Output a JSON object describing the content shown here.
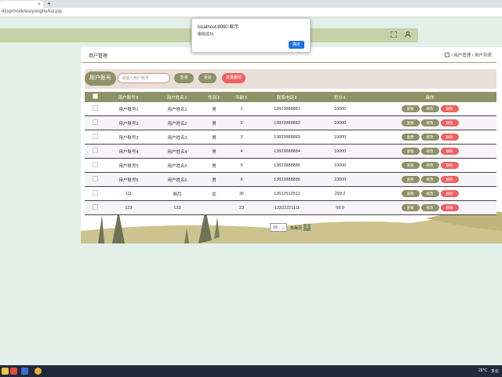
{
  "browser": {
    "url": "4/jsp/modules/yonghu/list.jsp",
    "new_tab": "+",
    "tab_close": "×"
  },
  "header": {
    "fullscreen_icon": "expand-icon",
    "user_icon": "user-icon"
  },
  "page": {
    "title": "用户管理",
    "breadcrumb": "/ 用户管理 / 用户列表"
  },
  "search": {
    "label": "用户账号",
    "placeholder": "请输入用户账号",
    "query_button": "查询",
    "add_button": "添加",
    "batch_delete_button": "批量删除"
  },
  "table": {
    "headers": [
      "",
      "用户账号⇕",
      "用户姓名⇕",
      "性别⇕",
      "年龄⇕",
      "联系电话⇕",
      "积分⇕",
      "操作"
    ],
    "rows": [
      [
        "用户账号1",
        "用户姓名1",
        "男",
        "1",
        "13823888881",
        "10000"
      ],
      [
        "用户账号2",
        "用户姓名2",
        "男",
        "2",
        "13823888882",
        "10000"
      ],
      [
        "用户账号3",
        "用户姓名3",
        "男",
        "3",
        "13823888883",
        "10000"
      ],
      [
        "用户账号4",
        "用户姓名4",
        "男",
        "4",
        "13823888884",
        "10000"
      ],
      [
        "用户账号5",
        "用户姓名5",
        "男",
        "5",
        "13823888885",
        "10000"
      ],
      [
        "用户账号6",
        "用户姓名6",
        "男",
        "6",
        "13823888886",
        "10000"
      ],
      [
        "111",
        "胡月",
        "女",
        "36",
        "13612512512",
        "299.2"
      ],
      [
        "123",
        "123",
        "",
        "23",
        "13322221111",
        "99.9"
      ]
    ],
    "action_view": "查看",
    "action_edit": "修改",
    "action_delete": "删除"
  },
  "pager": {
    "page_size": "10",
    "per_page_label": "条每页",
    "current_page": "1"
  },
  "alert": {
    "title": "localhost:8080 显示",
    "message": "删除成功",
    "ok": "确定"
  },
  "taskbar": {
    "weather": "26°C",
    "status": "多云"
  },
  "colors": {
    "olive": "#8d9267",
    "red": "#f06060",
    "header_band": "#c6d1a7",
    "background": "#e3efe9"
  }
}
